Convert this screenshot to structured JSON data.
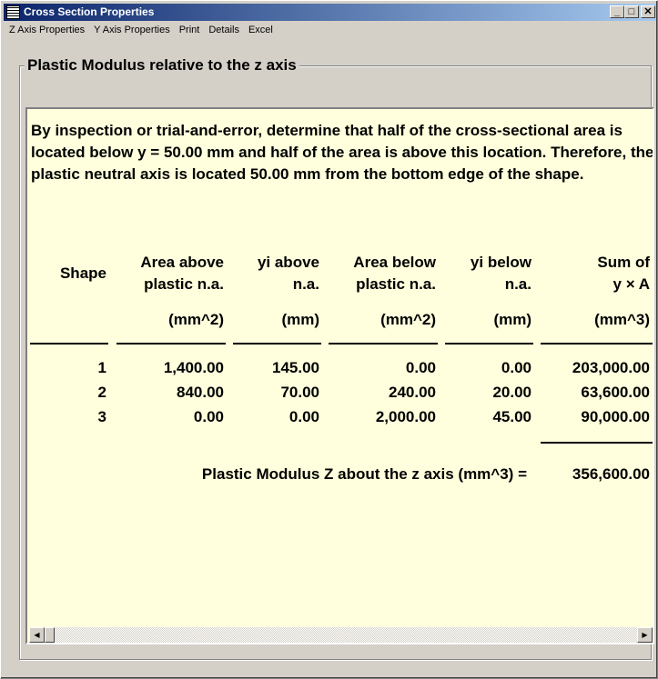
{
  "window": {
    "title": "Cross Section Properties",
    "minimize": "_",
    "maximize": "□",
    "close": "✕"
  },
  "menu": [
    "Z Axis Properties",
    "Y Axis Properties",
    "Print",
    "Details",
    "Excel"
  ],
  "group_title": "Plastic Modulus relative to the z axis",
  "paragraph": "By inspection or trial-and-error, determine that half of the cross-sectional area is located below y = 50.00 mm and half of the area is above this location.  Therefore, the plastic neutral axis is located 50.00 mm from the bottom edge of the shape.",
  "table": {
    "headers": [
      {
        "l1": "Shape",
        "l2": "",
        "unit": ""
      },
      {
        "l1": "Area above",
        "l2": "plastic n.a.",
        "unit": "(mm^2)"
      },
      {
        "l1": "yi above",
        "l2": "n.a.",
        "unit": "(mm)"
      },
      {
        "l1": "Area below",
        "l2": "plastic n.a.",
        "unit": "(mm^2)"
      },
      {
        "l1": "yi below",
        "l2": "n.a.",
        "unit": "(mm)"
      },
      {
        "l1": "Sum of",
        "l2": "y × A",
        "unit": "(mm^3)"
      }
    ],
    "rows": [
      [
        "1",
        "1,400.00",
        "145.00",
        "0.00",
        "0.00",
        "203,000.00"
      ],
      [
        "2",
        "840.00",
        "70.00",
        "240.00",
        "20.00",
        "63,600.00"
      ],
      [
        "3",
        "0.00",
        "0.00",
        "2,000.00",
        "45.00",
        "90,000.00"
      ]
    ],
    "total_label": "Plastic Modulus Z about the z axis (mm^3) =",
    "total_value": "356,600.00"
  },
  "scrollbar": {
    "left": "◀",
    "right": "▶"
  }
}
